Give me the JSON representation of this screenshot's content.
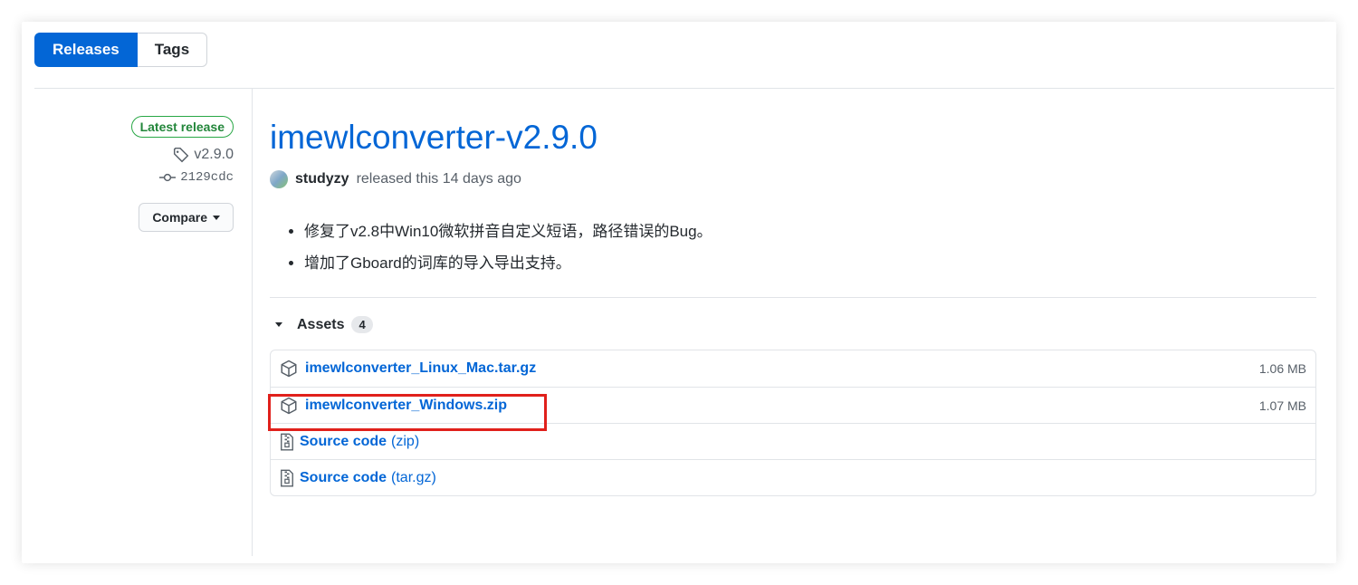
{
  "subnav": {
    "releases_label": "Releases",
    "tags_label": "Tags"
  },
  "sidebar": {
    "badge": "Latest release",
    "tag": "v2.9.0",
    "commit": "2129cdc",
    "compare_label": "Compare"
  },
  "release": {
    "title": "imewlconverter-v2.9.0",
    "author": "studyzy",
    "released_text": "released this 14 days ago",
    "notes": [
      "修复了v2.8中Win10微软拼音自定义短语，路径错误的Bug。",
      "增加了Gboard的词库的导入导出支持。"
    ]
  },
  "assets": {
    "heading": "Assets",
    "count": "4",
    "items": [
      {
        "name": "imewlconverter_Linux_Mac.tar.gz",
        "size": "1.06 MB"
      },
      {
        "name": "imewlconverter_Windows.zip",
        "size": "1.07 MB"
      },
      {
        "name": "Source code",
        "suffix": "(zip)"
      },
      {
        "name": "Source code",
        "suffix": "(tar.gz)"
      }
    ]
  },
  "colors": {
    "accent": "#0366d6",
    "badge_green": "#22863a",
    "highlight_red": "#e0201b"
  }
}
